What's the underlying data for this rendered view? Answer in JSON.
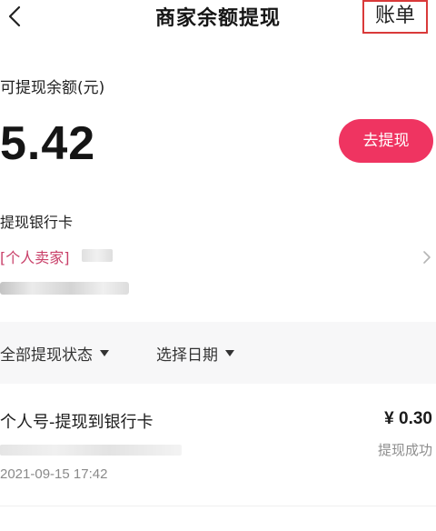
{
  "header": {
    "back_icon": "chevron-left-icon",
    "title": "商家余额提现",
    "bill_label": "账单",
    "bill_highlight_color": "#d93a3a"
  },
  "balance": {
    "label": "可提现余额(元)",
    "amount": "5.42",
    "withdraw_label": "去提现",
    "withdraw_color": "#ef3461"
  },
  "bank_card": {
    "label": "提现银行卡",
    "seller_tag": "[个人卖家]",
    "chevron_icon": "chevron-right-icon"
  },
  "filters": {
    "status_label": "全部提现状态",
    "date_label": "选择日期",
    "dropdown_icon": "triangle-down-icon"
  },
  "records": [
    {
      "title": "个人号-提现到银行卡",
      "amount": "¥ 0.30",
      "status": "提现成功",
      "time": "2021-09-15 17:42"
    }
  ]
}
